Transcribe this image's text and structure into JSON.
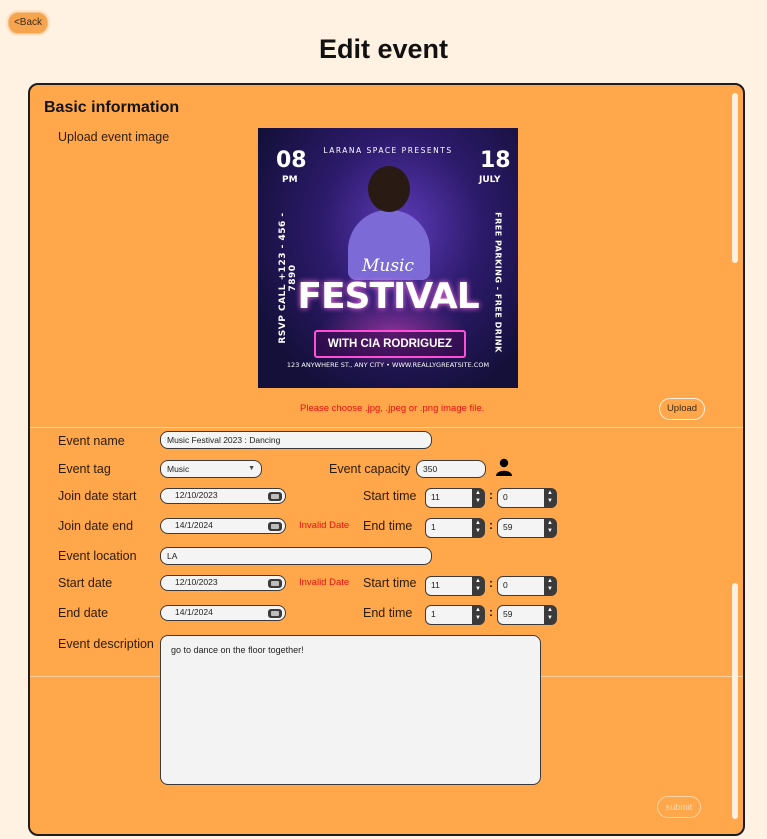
{
  "header": {
    "back_label": "<Back",
    "title": "Edit event"
  },
  "basic": {
    "section_title": "Basic information",
    "upload_label": "Upload event image",
    "image_error": "Please choose .jpg, .jpeg or .png image file.",
    "upload_button": "Upload",
    "poster": {
      "presents": "LARANA SPACE PRESENTS",
      "day_left": "08",
      "ampm": "PM",
      "day_right": "18",
      "month": "JULY",
      "music": "Music",
      "festival": "FESTIVAL",
      "with": "WITH CIA RODRIGUEZ",
      "address": "123 ANYWHERE ST., ANY CITY  •  WWW.REALLYGREATSITE.COM",
      "vertical_left": "RSVP CALL +123 - 456 - 7890",
      "vertical_right": "FREE PARKING - FREE DRINK"
    }
  },
  "form": {
    "event_name_label": "Event name",
    "event_name_value": "Music Festival 2023 : Dancing",
    "event_tag_label": "Event tag",
    "event_tag_value": "Music",
    "event_capacity_label": "Event capacity",
    "event_capacity_value": "350",
    "join_start_label": "Join date start",
    "join_start_value": "12/10/2023",
    "join_start_time_label": "Start time",
    "join_start_hour": "11",
    "join_start_min": "0",
    "join_end_label": "Join date end",
    "join_end_value": "14/1/2024",
    "join_end_error": "Invalid Date",
    "join_end_time_label": "End time",
    "join_end_hour": "1",
    "join_end_min": "59",
    "location_label": "Event location",
    "location_value": "LA",
    "start_date_label": "Start date",
    "start_date_value": "12/10/2023",
    "start_date_error": "Invalid Date",
    "start_time_label": "Start time",
    "start_hour": "11",
    "start_min": "0",
    "end_date_label": "End date",
    "end_date_value": "14/1/2024",
    "end_time_label": "End time",
    "end_hour": "1",
    "end_min": "59",
    "description_label": "Event description",
    "description_value": "go to dance on the floor together!",
    "submit_label": "submit",
    "colon": ":"
  },
  "icons": {
    "user": "user-icon",
    "calendar": "calendar-icon"
  },
  "colors": {
    "page_bg": "#fff2e2",
    "panel_bg": "#ffa74a",
    "error": "#e81010"
  }
}
